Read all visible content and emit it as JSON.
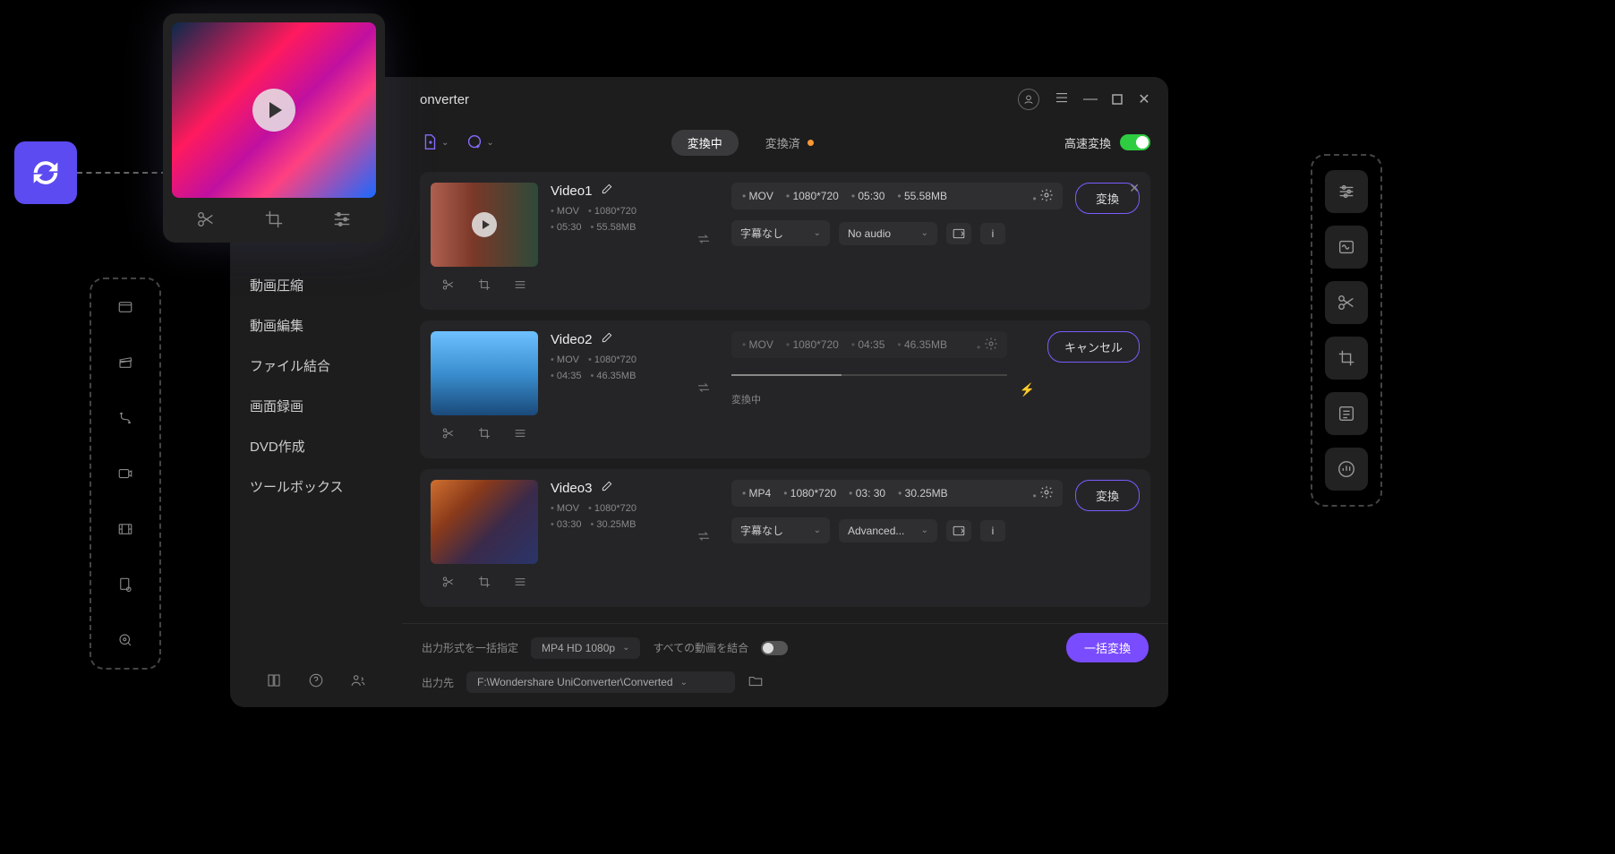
{
  "app": {
    "title_fragment": "onverter"
  },
  "toolbar": {
    "tab_converting": "変換中",
    "tab_converted": "変換済",
    "high_speed_label": "高速変換"
  },
  "sidebar": {
    "items": [
      "動画圧縮",
      "動画編集",
      "ファイル結合",
      "画面録画",
      "DVD作成",
      "ツールボックス"
    ]
  },
  "items": [
    {
      "name": "Video1",
      "src": {
        "fmt": "MOV",
        "res": "1080*720",
        "dur": "05:30",
        "size": "55.58MB"
      },
      "out": {
        "fmt": "MOV",
        "res": "1080*720",
        "dur": "05:30",
        "size": "55.58MB"
      },
      "sub": "字幕なし",
      "audio": "No audio",
      "action": "変換",
      "closable": true
    },
    {
      "name": "Video2",
      "src": {
        "fmt": "MOV",
        "res": "1080*720",
        "dur": "04:35",
        "size": "46.35MB"
      },
      "out": {
        "fmt": "MOV",
        "res": "1080*720",
        "dur": "04:35",
        "size": "46.35MB"
      },
      "action": "キャンセル",
      "status": "変換中",
      "processing": true
    },
    {
      "name": "Video3",
      "src": {
        "fmt": "MOV",
        "res": "1080*720",
        "dur": "03:30",
        "size": "30.25MB"
      },
      "out": {
        "fmt": "MP4",
        "res": "1080*720",
        "dur": "03: 30",
        "size": "30.25MB"
      },
      "sub": "字幕なし",
      "audio": "Advanced...",
      "action": "変換"
    }
  ],
  "footer": {
    "format_label": "出力形式を一括指定",
    "format_value": "MP4 HD 1080p",
    "merge_label": "すべての動画を結合",
    "output_label": "出力先",
    "output_path": "F:\\Wondershare UniConverter\\Converted",
    "batch_button": "一括変換"
  }
}
